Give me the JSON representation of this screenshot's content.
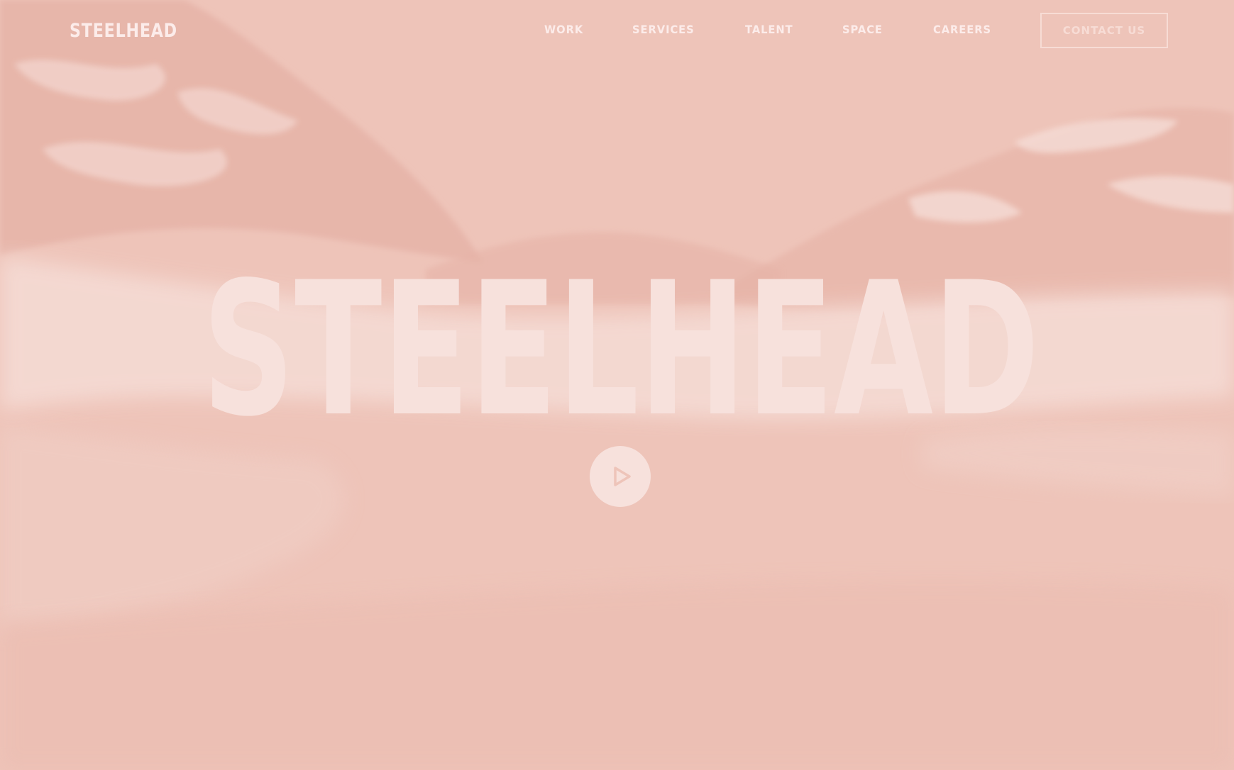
{
  "header": {
    "logo_text": "STEELHEAD"
  },
  "nav": {
    "items": [
      {
        "label": "WORK"
      },
      {
        "label": "SERVICES"
      },
      {
        "label": "TALENT"
      },
      {
        "label": "SPACE"
      },
      {
        "label": "CAREERS"
      }
    ],
    "contact_label": "CONTACT US"
  },
  "hero": {
    "wordmark": "STEELHEAD",
    "play_icon": "play-icon",
    "background": "mountain-landscape"
  },
  "colors": {
    "background_tint": "#eec4b9",
    "text_light": "#fcecea",
    "wordmark": "#f7e1dc",
    "contact_border": "#f7dcd5"
  }
}
